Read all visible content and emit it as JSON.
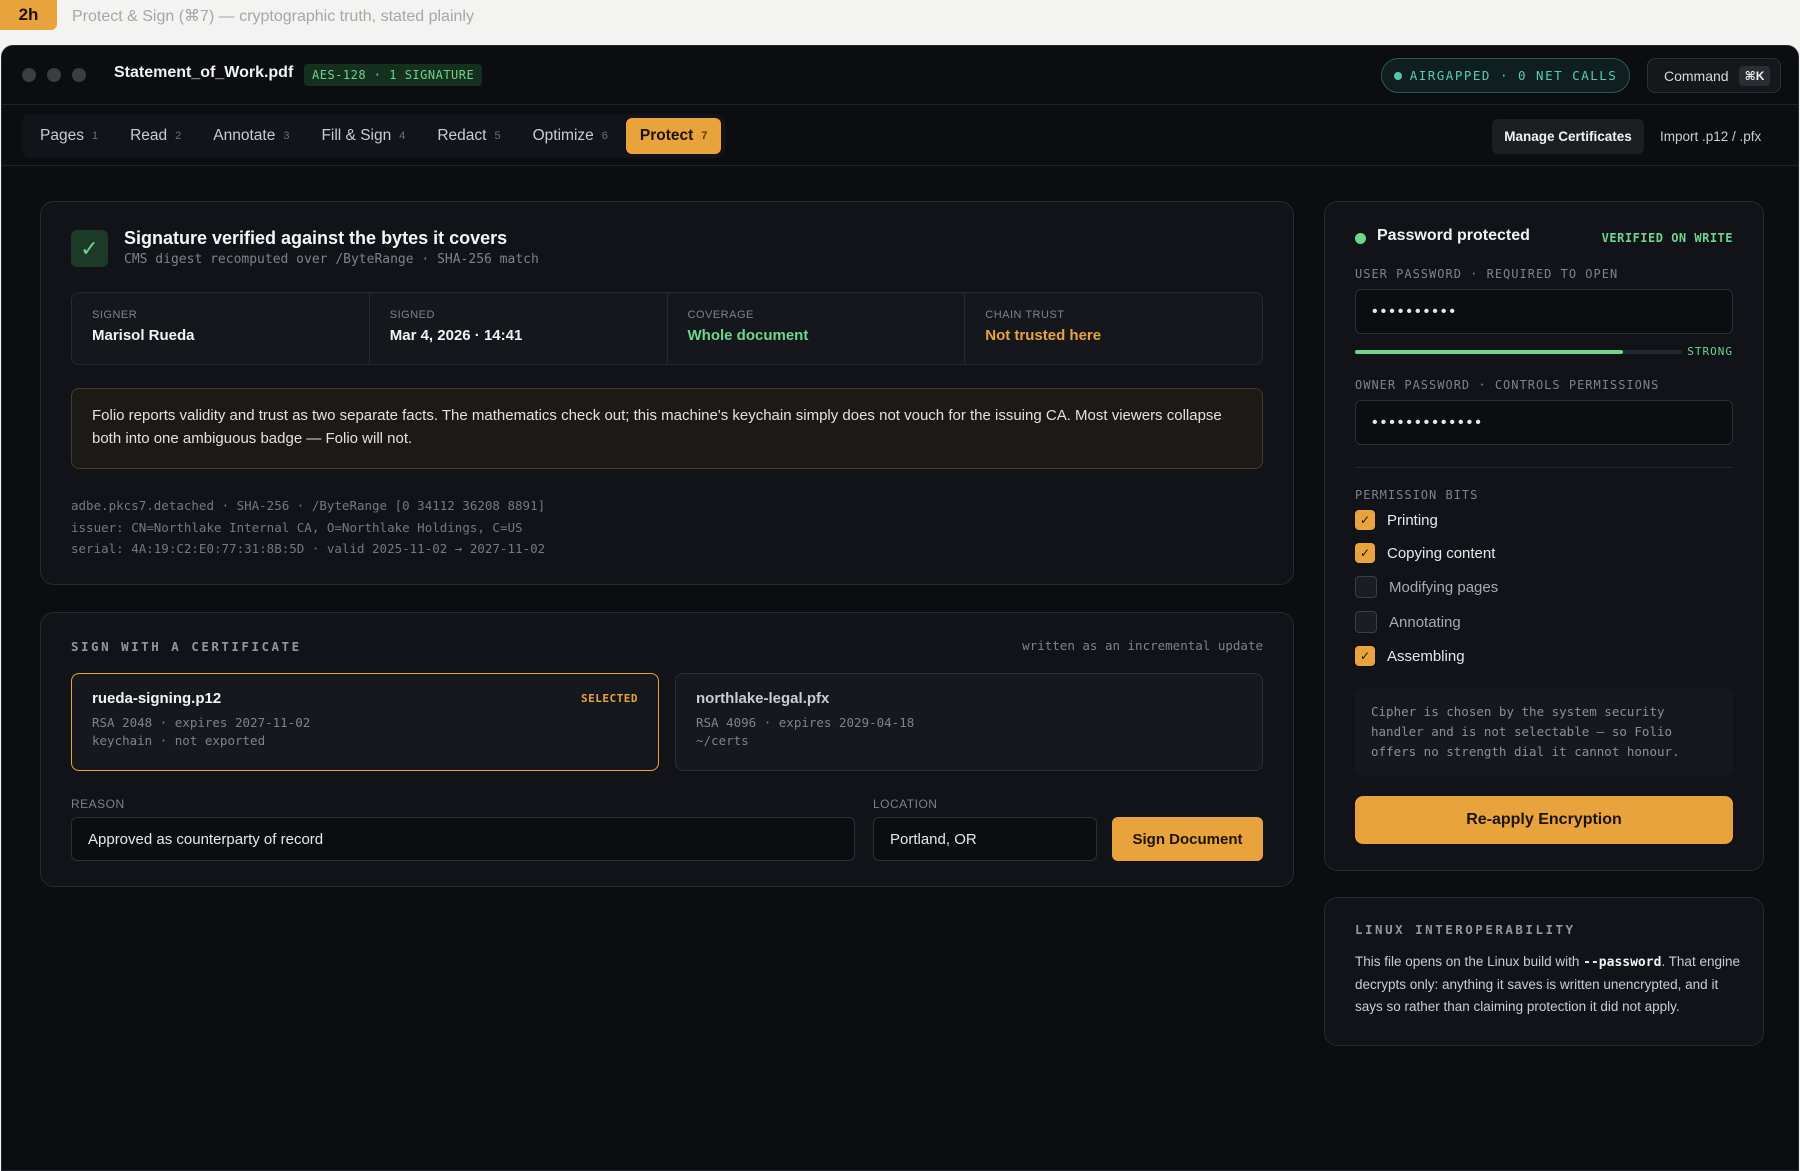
{
  "caption": {
    "badge": "2h",
    "text": "Protect & Sign (⌘7) — cryptographic truth, stated plainly"
  },
  "titlebar": {
    "doc_title": "Statement_of_Work.pdf",
    "enc_badge": "AES-128 · 1 SIGNATURE",
    "airgap": "AIRGAPPED · 0 NET CALLS",
    "command_label": "Command",
    "command_kbd": "⌘K"
  },
  "tabs": [
    {
      "label": "Pages",
      "num": "1"
    },
    {
      "label": "Read",
      "num": "2"
    },
    {
      "label": "Annotate",
      "num": "3"
    },
    {
      "label": "Fill & Sign",
      "num": "4"
    },
    {
      "label": "Redact",
      "num": "5"
    },
    {
      "label": "Optimize",
      "num": "6"
    },
    {
      "label": "Protect",
      "num": "7"
    }
  ],
  "actions": {
    "manage_certs": "Manage Certificates",
    "import": "Import .p12 / .pfx"
  },
  "verify": {
    "title": "Signature verified against the bytes it covers",
    "subtitle": "CMS digest recomputed over /ByteRange · SHA-256 match",
    "facts": [
      {
        "label": "SIGNER",
        "value": "Marisol Rueda"
      },
      {
        "label": "SIGNED",
        "value": "Mar 4, 2026 · 14:41"
      },
      {
        "label": "COVERAGE",
        "value": "Whole document"
      },
      {
        "label": "CHAIN TRUST",
        "value": "Not trusted here"
      }
    ],
    "note": "Folio reports validity and trust as two separate facts. The mathematics check out; this machine's keychain simply does not vouch for the issuing CA. Most viewers collapse both into one ambiguous badge — Folio will not.",
    "meta": [
      "adbe.pkcs7.detached · SHA-256 · /ByteRange [0 34112 36208 8891]",
      "issuer: CN=Northlake Internal CA, O=Northlake Holdings, C=US",
      "serial: 4A:19:C2:E0:77:31:8B:5D · valid 2025-11-02 → 2027-11-02"
    ]
  },
  "sign": {
    "heading": "SIGN WITH A CERTIFICATE",
    "aside": "written as an incremental update",
    "certs": [
      {
        "name": "rueda-signing.p12",
        "line1": "RSA 2048 · expires 2027-11-02",
        "line2": "keychain · not exported",
        "badge": "SELECTED"
      },
      {
        "name": "northlake-legal.pfx",
        "line1": "RSA 4096 · expires 2029-04-18",
        "line2": "~/certs"
      }
    ],
    "reason_label": "REASON",
    "reason_value": "Approved as counterparty of record",
    "location_label": "LOCATION",
    "location_value": "Portland, OR",
    "button": "Sign Document"
  },
  "protect": {
    "title": "Password protected",
    "badge": "VERIFIED ON WRITE",
    "user_label": "USER PASSWORD · REQUIRED TO OPEN",
    "user_value": "••••••••••",
    "strength_label": "STRONG",
    "strength": 0.82,
    "owner_label": "OWNER PASSWORD · CONTROLS PERMISSIONS",
    "owner_value": "•••••••••••••",
    "perm_heading": "PERMISSION BITS",
    "permissions": [
      {
        "label": "Printing",
        "checked": true
      },
      {
        "label": "Copying content",
        "checked": true
      },
      {
        "label": "Modifying pages",
        "checked": false
      },
      {
        "label": "Annotating",
        "checked": false
      },
      {
        "label": "Assembling",
        "checked": true
      }
    ],
    "cipher_note": "Cipher is chosen by the system security handler and is not selectable — so Folio offers no strength dial it cannot honour.",
    "button": "Re-apply Encryption"
  },
  "linux": {
    "heading": "LINUX INTEROPERABILITY",
    "text_before": "This file opens on the Linux build with ",
    "code": "--password",
    "text_after": ". That engine decrypts only: anything it saves is written unencrypted, and it says so rather than claiming protection it did not apply."
  },
  "colors": {
    "accent": "#e8a33d",
    "success": "#6fd48e",
    "background": "#0c0d10"
  }
}
